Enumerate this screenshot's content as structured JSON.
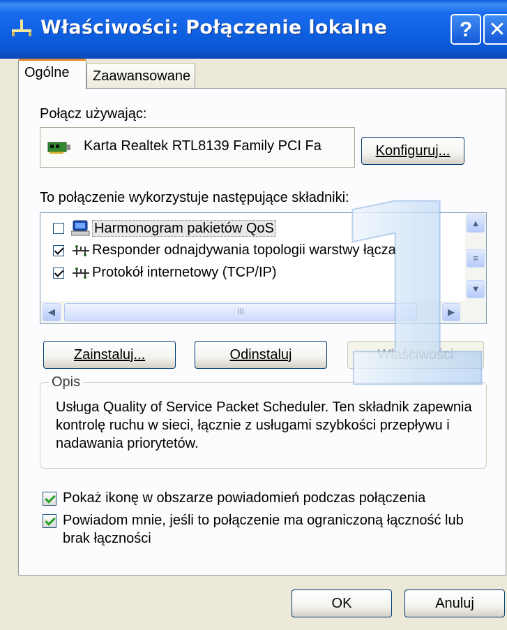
{
  "window": {
    "title": "Właściwości: Połączenie lokalne",
    "help_glyph": "?",
    "close_glyph": "✕"
  },
  "tabs": [
    {
      "label": "Ogólne",
      "active": true
    },
    {
      "label": "Zaawansowane",
      "active": false
    }
  ],
  "connect_using": {
    "label": "Połącz używając:",
    "adapter_name": "Karta Realtek RTL8139 Family PCI Fa",
    "configure_button": "Konfiguruj..."
  },
  "components": {
    "label": "To połączenie wykorzystuje następujące składniki:",
    "items": [
      {
        "label": "Harmonogram pakietów QoS",
        "checked": false,
        "icon": "network-scheduler-icon",
        "selected": true
      },
      {
        "label": "Responder odnajdywania topologii warstwy łącza",
        "checked": true,
        "icon": "network-protocol-icon",
        "selected": false
      },
      {
        "label": "Protokół internetowy (TCP/IP)",
        "checked": true,
        "icon": "network-protocol-icon",
        "selected": false
      }
    ],
    "scroll_up": "▲",
    "scroll_down": "▼",
    "scroll_left": "◀",
    "scroll_right": "▶",
    "thumb_grip": "III",
    "vthumb_grip": "≡"
  },
  "actions": {
    "install": "Zainstaluj...",
    "uninstall": "Odinstaluj",
    "properties": "Właściwości"
  },
  "description": {
    "legend": "Opis",
    "text": "Usługa Quality of Service Packet Scheduler. Ten składnik zapewnia kontrolę ruchu w sieci, łącznie z usługami szybkości przepływu i nadawania priorytetów."
  },
  "options": [
    {
      "label": "Pokaż ikonę w obszarze powiadomień podczas połączenia",
      "checked": true
    },
    {
      "label": "Powiadom mnie, jeśli to połączenie ma ograniczoną łączność lub brak łączności",
      "checked": true
    }
  ],
  "footer": {
    "ok": "OK",
    "cancel": "Anuluj"
  },
  "watermark": "1",
  "colors": {
    "titlebar": "#0b57d2",
    "active_tab_accent": "#e68b2c",
    "checkbox_check": "#21a121"
  }
}
